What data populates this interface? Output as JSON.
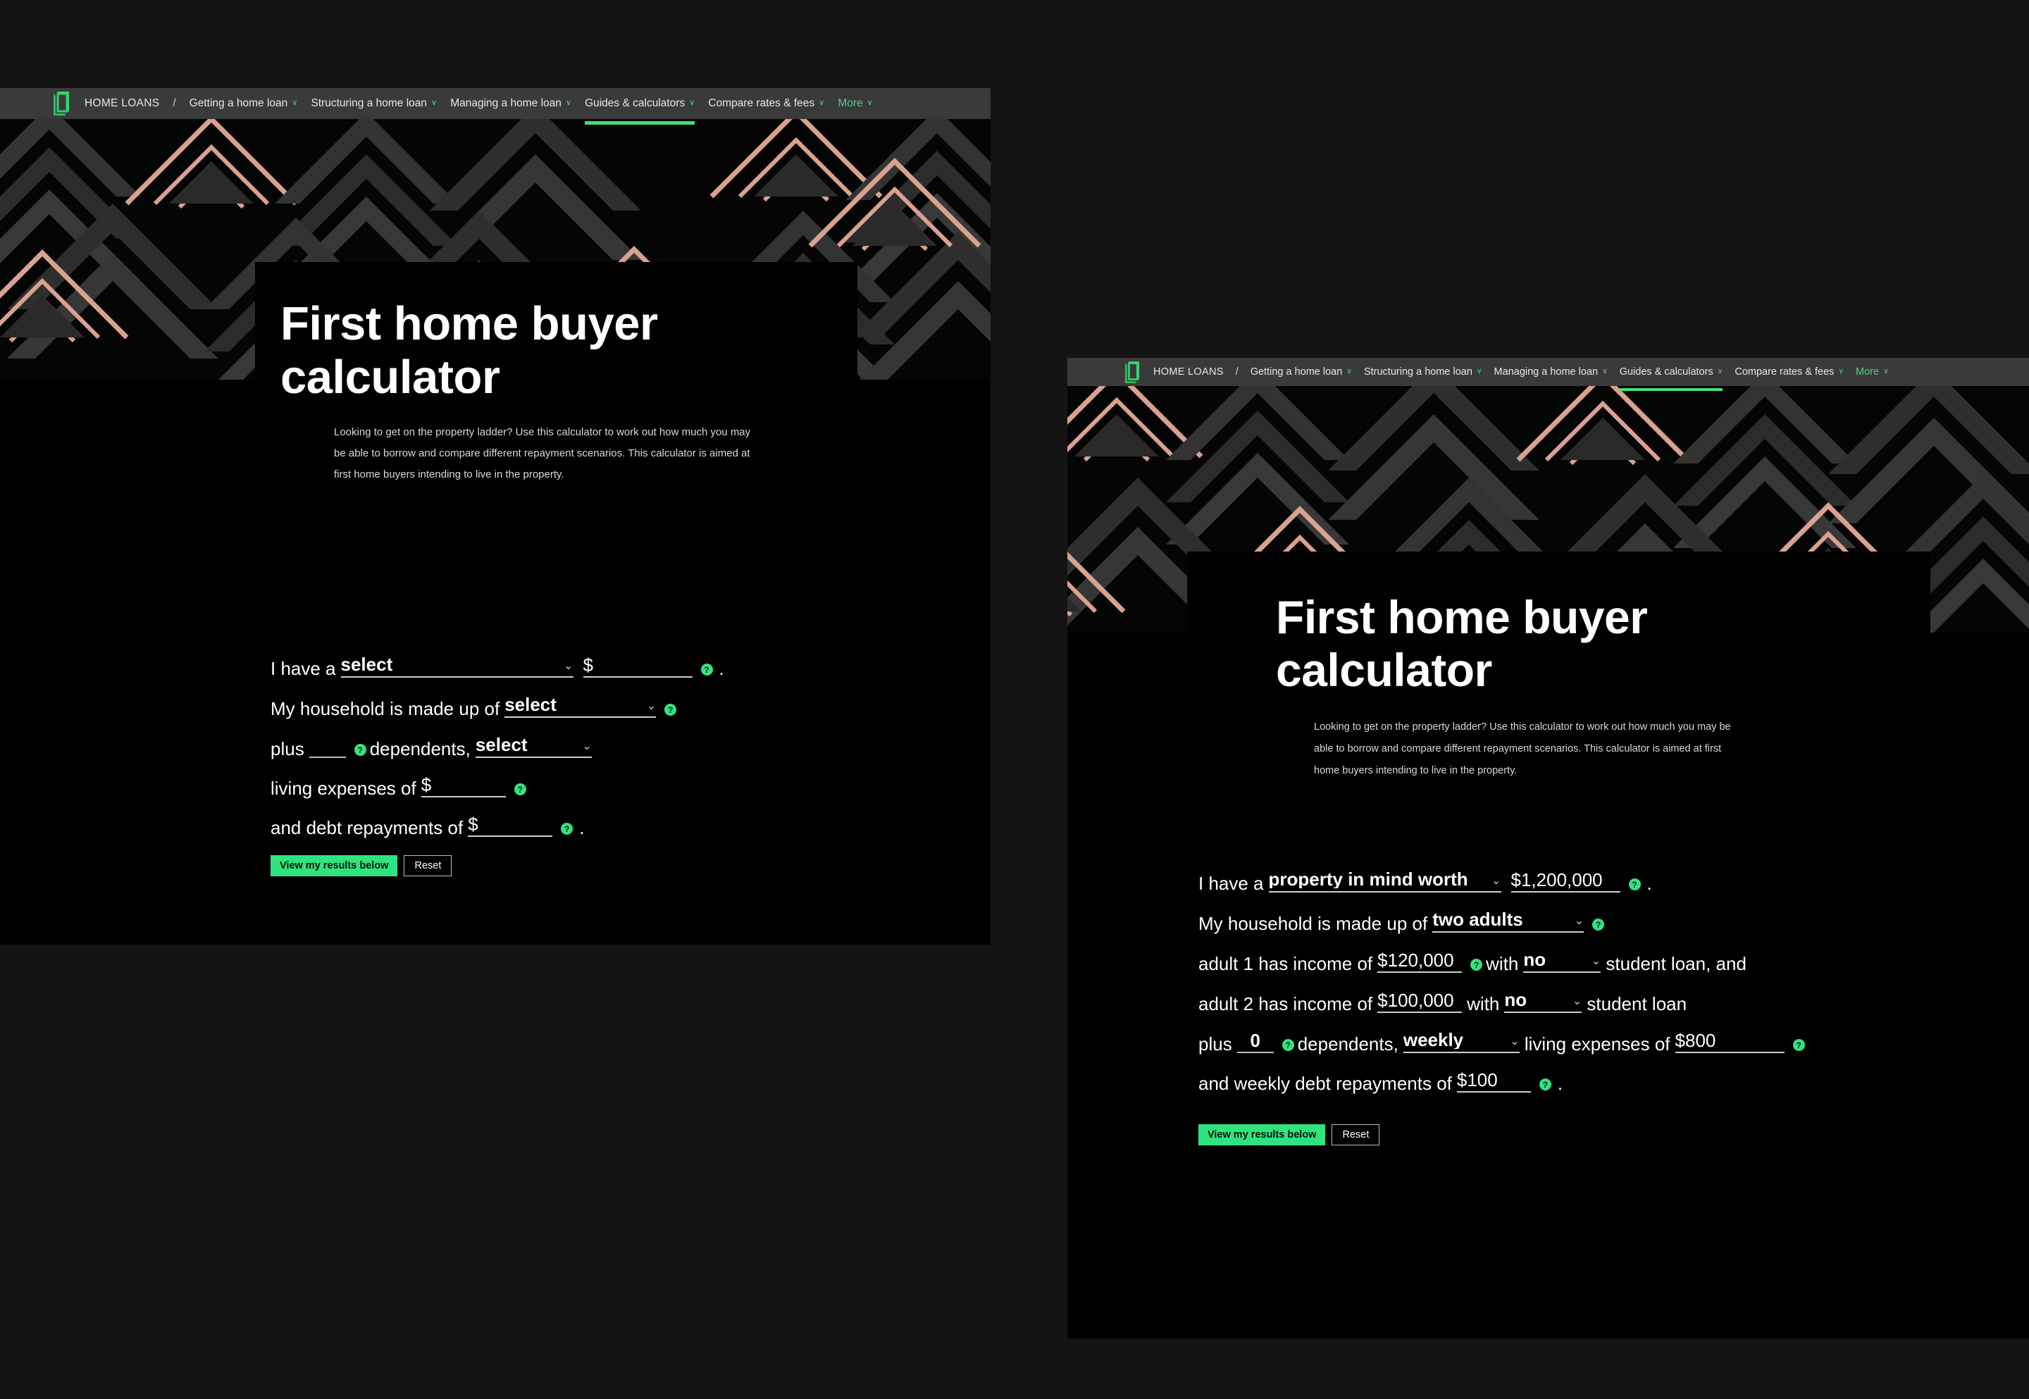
{
  "nav": {
    "logo_name": "westpac-logo",
    "brand": "HOME LOANS",
    "separator": "/",
    "items": [
      {
        "label": "Getting a home loan",
        "caret": "∨",
        "state": "normal"
      },
      {
        "label": "Structuring a home loan",
        "caret": "∨",
        "state": "normal"
      },
      {
        "label": "Managing a home loan",
        "caret": "∨",
        "state": "normal"
      },
      {
        "label": "Guides & calculators",
        "caret": "∨",
        "state": "active"
      },
      {
        "label": "Compare rates & fees",
        "caret": "∨",
        "state": "normal"
      },
      {
        "label": "More",
        "caret": "∨",
        "state": "muted"
      }
    ],
    "active_underline_color": "#3ee07f"
  },
  "hero": {
    "title_line1": "First home buyer",
    "title_line2": "calculator",
    "description": "Looking to get on the property ladder? Use this calculator to work out how much you may be able to borrow and compare different repayment scenarios. This calculator is aimed at first home buyers intending to live in the property."
  },
  "buttons": {
    "primary_label": "View my results below",
    "secondary_label": "Reset",
    "primary_color": "#2fe47f"
  },
  "help_icon": {
    "glyph": "?",
    "name": "help-icon",
    "color": "#33e383"
  },
  "caret_glyph": "⌄",
  "panel_empty": {
    "row1": {
      "lead": "I have a",
      "select_value": "select",
      "amount_prefix": "$",
      "amount_value": "",
      "trailing": "."
    },
    "row2": {
      "lead": "My household is made up of",
      "select_value": "select"
    },
    "row3": {
      "lead": "plus",
      "dependents_value": "",
      "mid": "dependents,",
      "frequency_value": "select"
    },
    "row4": {
      "lead": "living expenses of",
      "amount_prefix": "$",
      "amount_value": ""
    },
    "row5": {
      "lead": "and debt repayments of",
      "amount_prefix": "$",
      "amount_value": "",
      "trailing": "."
    }
  },
  "panel_filled": {
    "row1": {
      "lead": "I have a",
      "select_value": "property in mind worth",
      "amount_value": "$1,200,000",
      "trailing": "."
    },
    "row2": {
      "lead": "My household is made up of",
      "select_value": "two adults"
    },
    "row3": {
      "lead": "adult 1 has income of",
      "income_value": "$120,000",
      "mid": "with",
      "student_loan_value": "no",
      "tail": "student loan, and"
    },
    "row4": {
      "lead": "adult 2 has income of",
      "income_value": "$100,000",
      "mid": "with",
      "student_loan_value": "no",
      "tail": "student loan"
    },
    "row5": {
      "lead": "plus",
      "dependents_value": "0",
      "mid": "dependents,",
      "frequency_value": "weekly",
      "expenses_label": "living expenses of",
      "expenses_value": "$800"
    },
    "row6": {
      "lead": "and weekly debt repayments of",
      "amount_value": "$100",
      "trailing": "."
    }
  }
}
